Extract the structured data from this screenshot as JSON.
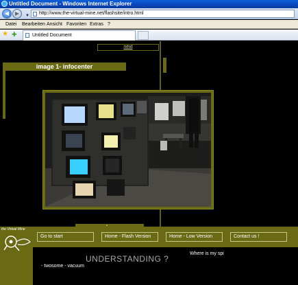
{
  "window": {
    "title": "Untitled Document - Windows Internet Explorer"
  },
  "address": {
    "url": "http://www.the-virtual-mine.net/flashsite/intro.html"
  },
  "menu": [
    "Datei",
    "Bearbeiten",
    "Ansicht",
    "Favoriten",
    "Extras",
    "?"
  ],
  "tab": {
    "title": "Untitled Document"
  },
  "page": {
    "next_link": "next",
    "section_title": "image 1- infocenter",
    "caption_marker": "•",
    "nav": [
      "Go to start",
      "Home - Flash Version",
      "Home - Low Version",
      "Contact us !"
    ],
    "logo_text": "the Virtual Mine",
    "heading": "UNDERSTANDING ?",
    "left_text": "- twosome - vacuum",
    "right_text": "Where is my spi"
  },
  "colors": {
    "olive": "#6b6a14",
    "titlebar": "#0b45b8"
  }
}
